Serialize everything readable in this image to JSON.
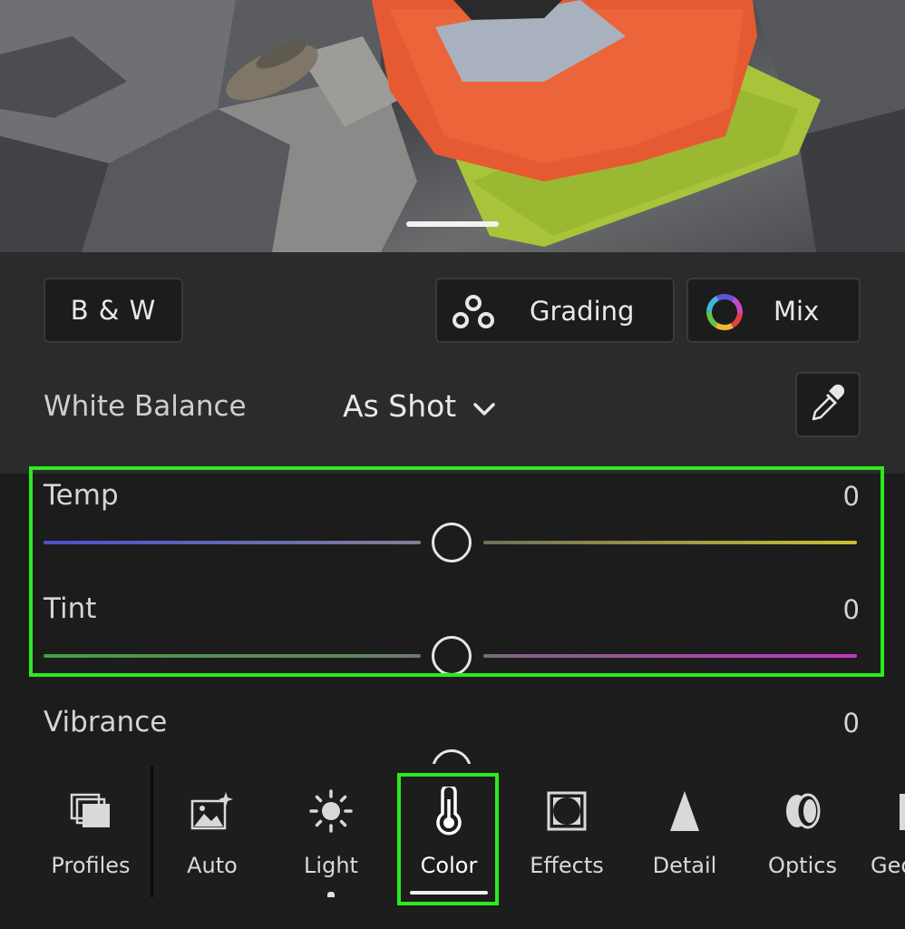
{
  "panel": {
    "bw_label": "B & W",
    "grading_label": "Grading",
    "mix_label": "Mix"
  },
  "white_balance": {
    "label": "White Balance",
    "value": "As Shot"
  },
  "sliders": {
    "temp": {
      "label": "Temp",
      "value": "0"
    },
    "tint": {
      "label": "Tint",
      "value": "0"
    },
    "vibrance": {
      "label": "Vibrance",
      "value": "0"
    }
  },
  "toolbar": {
    "items": [
      {
        "label": "Profiles",
        "icon": "profiles-icon"
      },
      {
        "label": "Auto",
        "icon": "auto-icon"
      },
      {
        "label": "Light",
        "icon": "light-icon"
      },
      {
        "label": "Color",
        "icon": "thermometer-icon",
        "active": true
      },
      {
        "label": "Effects",
        "icon": "effects-icon"
      },
      {
        "label": "Detail",
        "icon": "detail-icon"
      },
      {
        "label": "Optics",
        "icon": "optics-icon"
      },
      {
        "label": "Geo",
        "icon": "geometry-icon"
      }
    ]
  },
  "colors": {
    "highlight": "#2dea1f",
    "panel_bg": "#2b2b2b",
    "sliders_bg": "#1c1c1c"
  }
}
